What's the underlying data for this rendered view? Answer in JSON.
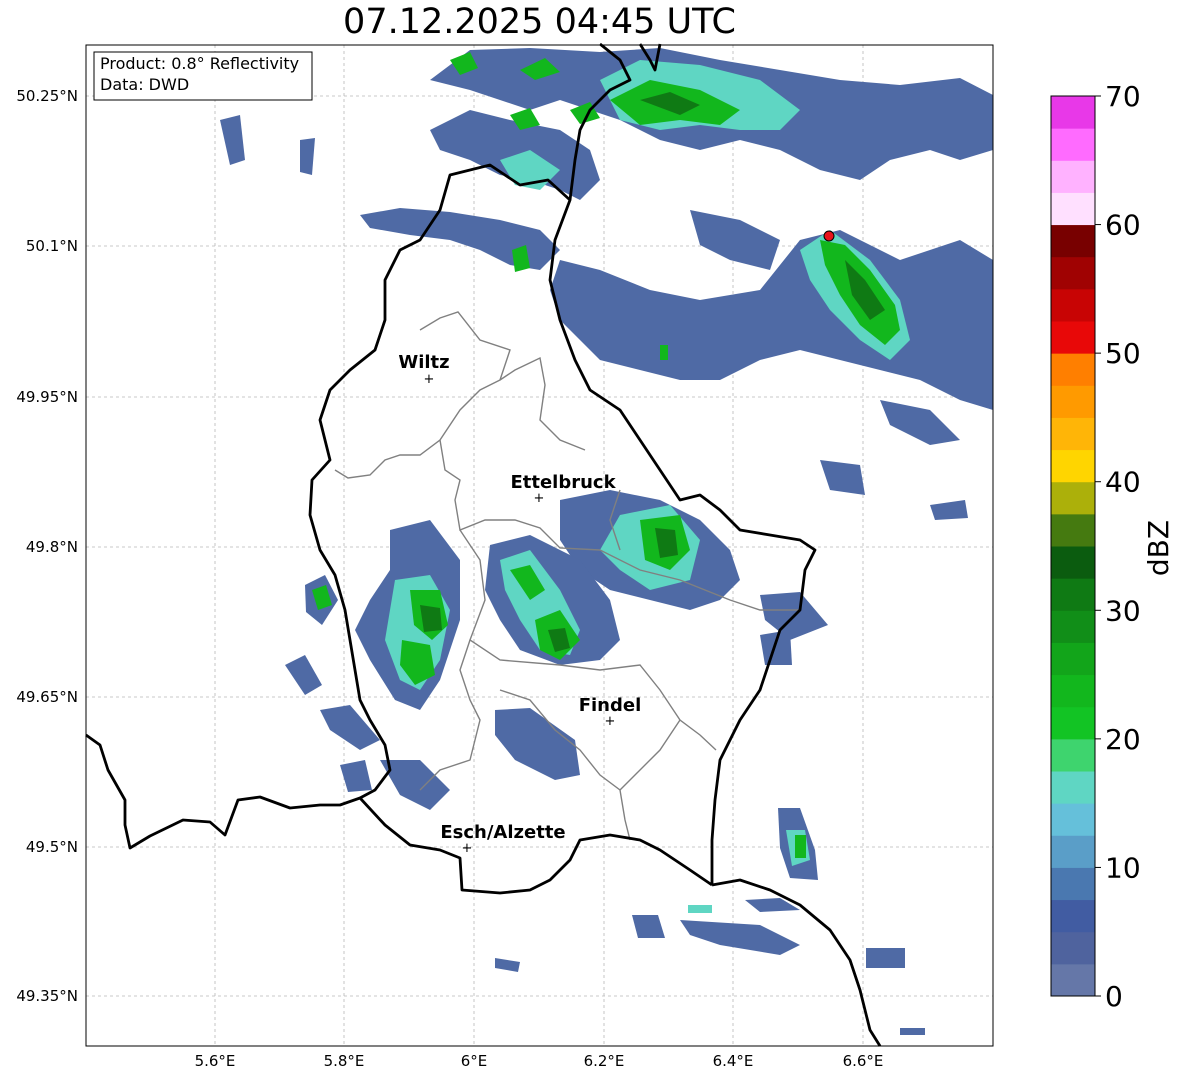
{
  "title": "07.12.2025 04:45 UTC",
  "info_box": {
    "product": "Product: 0.8° Reflectivity",
    "data": "Data: DWD"
  },
  "map": {
    "lon_range": [
      5.4,
      6.8
    ],
    "lat_range": [
      49.3,
      50.3
    ],
    "grid": true,
    "lat_labels": [
      "50.25°N",
      "50.1°N",
      "49.95°N",
      "49.8°N",
      "49.65°N",
      "49.5°N",
      "49.35°N"
    ],
    "lon_labels": [
      "5.6°E",
      "5.8°E",
      "6°E",
      "6.2°E",
      "6.4°E",
      "6.6°E"
    ],
    "cities": [
      {
        "name": "Wiltz",
        "marker": "+"
      },
      {
        "name": "Ettelbruck",
        "marker": "+"
      },
      {
        "name": "Findel",
        "marker": "+"
      },
      {
        "name": "Esch/Alzette",
        "marker": "+"
      }
    ],
    "radar_site_color": "#e8141c",
    "border_color": "#000000",
    "canton_border_color": "#808080"
  },
  "colorbar": {
    "label": "dBZ",
    "ticks": [
      "0",
      "10",
      "20",
      "30",
      "40",
      "50",
      "60",
      "70"
    ],
    "min": 0,
    "max": 70,
    "step": 2.5,
    "colors": [
      "#6577a8",
      "#4f639e",
      "#415ca2",
      "#4a78b0",
      "#5a9ec8",
      "#65c0da",
      "#5fd6c3",
      "#3ed46e",
      "#12c424",
      "#12b71d",
      "#12a51a",
      "#118e18",
      "#0f7a14",
      "#0b5c0f",
      "#457a10",
      "#acb00a",
      "#ffd500",
      "#ffb507",
      "#ff9a00",
      "#ff7f00",
      "#e80808",
      "#c80404",
      "#a00202",
      "#780000",
      "#ffe0ff",
      "#ffb2ff",
      "#ff6bff",
      "#e838e8"
    ]
  }
}
